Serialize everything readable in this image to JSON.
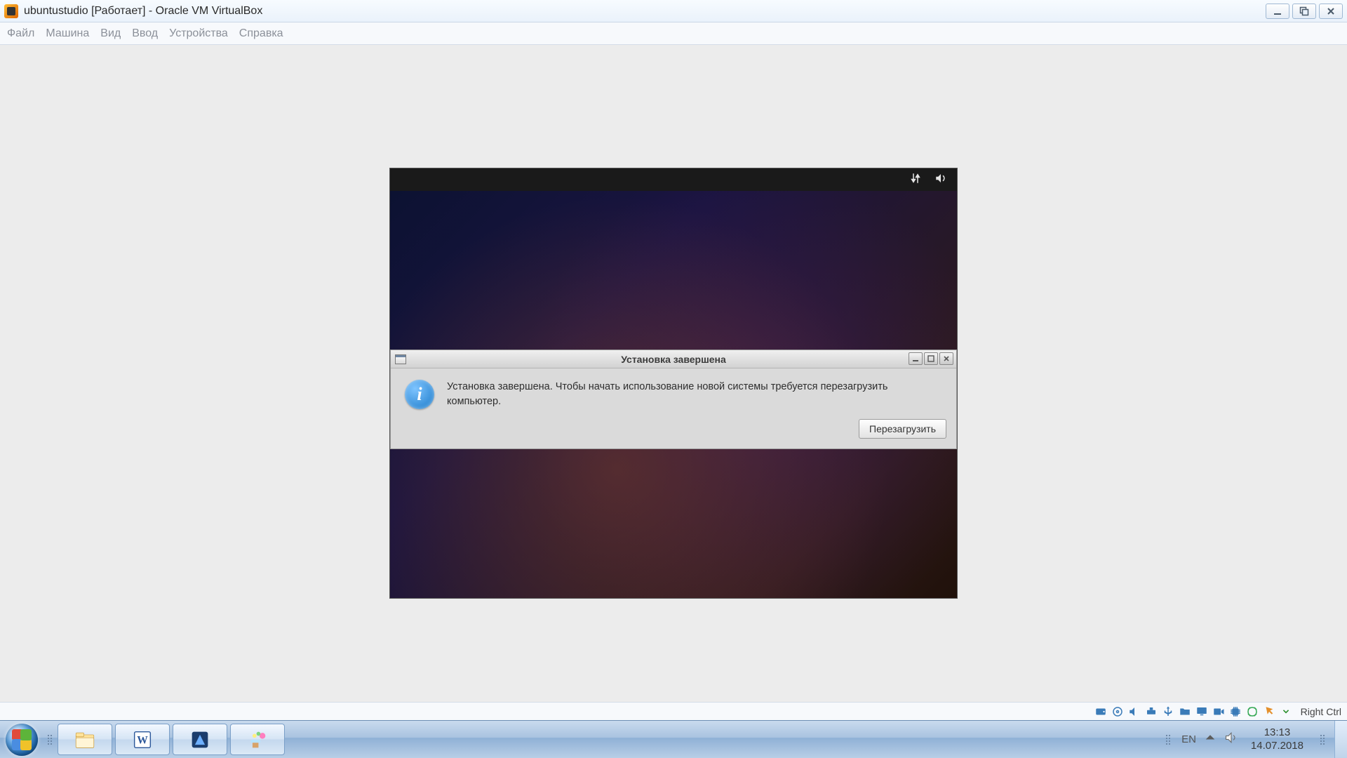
{
  "titlebar": {
    "title": "ubuntustudio [Работает] - Oracle VM VirtualBox"
  },
  "menu": {
    "file": "Файл",
    "machine": "Машина",
    "view": "Вид",
    "input": "Ввод",
    "devices": "Устройства",
    "help": "Справка"
  },
  "dialog": {
    "title": "Установка завершена",
    "message": "Установка завершена. Чтобы начать использование новой системы требуется перезагрузить компьютер.",
    "restart": "Перезагрузить"
  },
  "statusbar": {
    "host_key": "Right Ctrl"
  },
  "tray": {
    "lang": "EN",
    "time": "13:13",
    "date": "14.07.2018"
  }
}
